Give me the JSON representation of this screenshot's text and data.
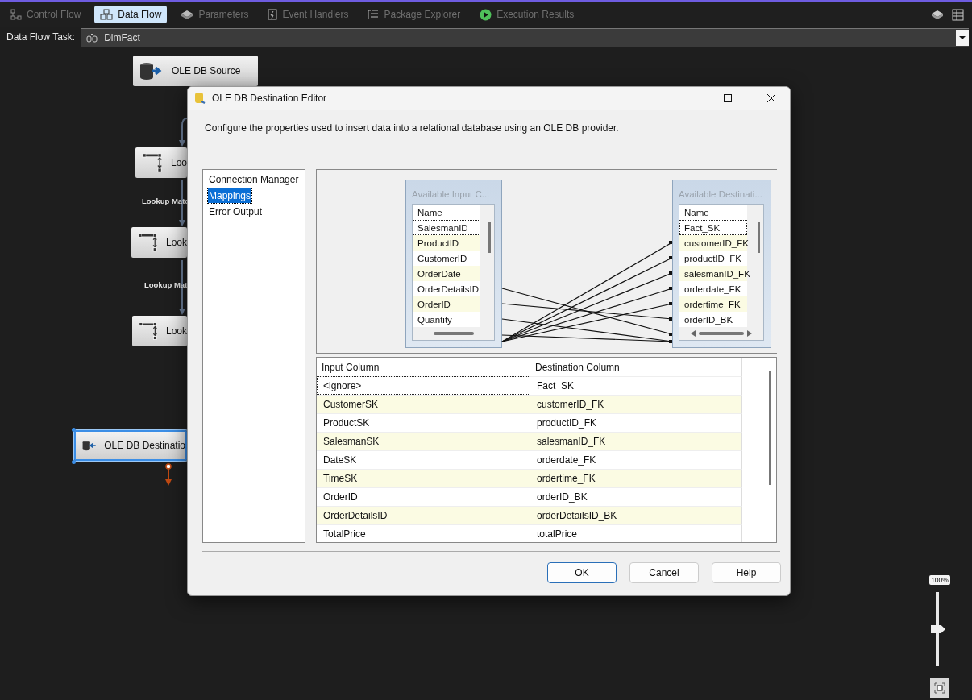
{
  "tabs": [
    {
      "label": "Control Flow",
      "selected": false
    },
    {
      "label": "Data Flow",
      "selected": true
    },
    {
      "label": "Parameters",
      "selected": false
    },
    {
      "label": "Event Handlers",
      "selected": false
    },
    {
      "label": "Package Explorer",
      "selected": false
    },
    {
      "label": "Execution Results",
      "selected": false
    }
  ],
  "task_bar": {
    "label": "Data Flow Task:",
    "value": "DimFact"
  },
  "canvas": {
    "nodes": [
      {
        "kind": "source",
        "label": "OLE DB Source",
        "selected": false
      },
      {
        "kind": "lookup",
        "label": "Loo",
        "selected": false
      },
      {
        "kind": "lookup",
        "label": "Look",
        "selected": false
      },
      {
        "kind": "lookup",
        "label": "Look",
        "selected": false
      },
      {
        "kind": "destination",
        "label": "OLE DB Destinatio",
        "selected": true
      }
    ],
    "path_labels": [
      "Lookup Matc",
      "Lookup Mat"
    ]
  },
  "dialog": {
    "title": "OLE DB Destination Editor",
    "description": "Configure the properties used to insert data into a relational database using an OLE DB provider.",
    "nav": [
      {
        "label": "Connection Manager",
        "selected": false
      },
      {
        "label": "Mappings",
        "selected": true
      },
      {
        "label": "Error Output",
        "selected": false
      }
    ],
    "input_columns": {
      "title": "Available Input C...",
      "header": "Name",
      "items": [
        "SalesmanID",
        "ProductID",
        "CustomerID",
        "OrderDate",
        "OrderDetailsID",
        "OrderID",
        "Quantity"
      ]
    },
    "destination_columns": {
      "title": "Available Destinati...",
      "header": "Name",
      "items": [
        "Fact_SK",
        "customerID_FK",
        "productID_FK",
        "salesmanID_FK",
        "orderdate_FK",
        "ordertime_FK",
        "orderID_BK"
      ]
    },
    "table": {
      "columns": [
        "Input Column",
        "Destination Column"
      ],
      "rows": [
        [
          "<ignore>",
          "Fact_SK"
        ],
        [
          "CustomerSK",
          "customerID_FK"
        ],
        [
          "ProductSK",
          "productID_FK"
        ],
        [
          "SalesmanSK",
          "salesmanID_FK"
        ],
        [
          "DateSK",
          "orderdate_FK"
        ],
        [
          "TimeSK",
          "ordertime_FK"
        ],
        [
          "OrderID",
          "orderID_BK"
        ],
        [
          "OrderDetailsID",
          "orderDetailsID_BK"
        ],
        [
          "TotalPrice",
          "totalPrice"
        ]
      ]
    },
    "buttons": [
      "OK",
      "Cancel",
      "Help"
    ]
  },
  "zoom": {
    "reading": "100%",
    "level": 0.5
  }
}
